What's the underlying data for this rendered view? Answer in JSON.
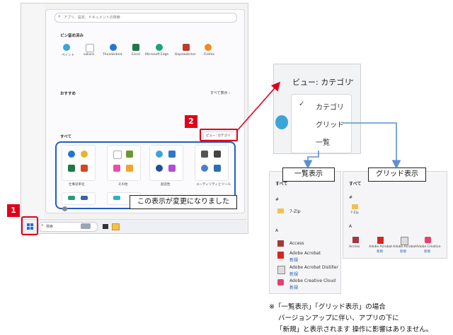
{
  "start_menu": {
    "search_placeholder": "アプリ、設定、ドキュメントの検索",
    "pinned_header": "ピン留め済み",
    "pinned_apps": [
      {
        "label": "ペイント",
        "color": "#3ba4d9"
      },
      {
        "label": "sakura",
        "color": "#ee6fa0"
      },
      {
        "label": "Thunderbird",
        "color": "#2276d8"
      },
      {
        "label": "Excel",
        "color": "#1d7a44"
      },
      {
        "label": "Microsoft Edge",
        "color": "#1aa27c"
      },
      {
        "label": "Dopewatcher",
        "color": "#c23b2a"
      },
      {
        "label": "Firefox",
        "color": "#f28a1e"
      }
    ],
    "recommended_header": "おすすめ",
    "show_all": "すべて表示 ›",
    "all_header": "すべて",
    "view_button": "ビュー: カテゴリ",
    "category_labels": [
      "仕事効率化",
      "その他",
      "創造性",
      "ユーティリティとツール"
    ],
    "user_icon": "user-icon"
  },
  "taskbar": {
    "search_text": "検索"
  },
  "annotations": {
    "badge1": "1",
    "badge2": "2",
    "changed_note": "この表示が変更になりました",
    "list_view_label": "一覧表示",
    "grid_view_label": "グリッド表示",
    "footnote_line1": "※「一覧表示」「グリッド表示」の場合",
    "footnote_line2": "バージョンアップに伴い、アプリの下に",
    "footnote_line3": "「新規」と表示されます 操作に影響はありません。"
  },
  "view_dropdown": {
    "button_label": "ビュー: カテゴリ",
    "options": [
      {
        "label": "カテゴリ",
        "checked": true
      },
      {
        "label": "グリッド",
        "checked": false
      },
      {
        "label": "一覧",
        "checked": false
      }
    ]
  },
  "list_panel": {
    "header": "すべて",
    "sections": [
      {
        "letter": "#",
        "items": [
          {
            "name": "7-Zip",
            "sub": ""
          }
        ]
      },
      {
        "letter": "A",
        "items": [
          {
            "name": "Access",
            "sub": ""
          },
          {
            "name": "Adobe Acrobat",
            "sub": "新規"
          },
          {
            "name": "Adobe Acrobat Distiller",
            "sub": "新規"
          },
          {
            "name": "Adobe Creative Cloud",
            "sub": "新規"
          }
        ]
      }
    ]
  },
  "grid_panel": {
    "header": "すべて",
    "hash": "#",
    "zip": "7-Zip",
    "letter_a": "A",
    "apps": [
      {
        "name": "Access",
        "sub": ""
      },
      {
        "name": "Adobe Acrobat",
        "sub": "新規"
      },
      {
        "name": "Adobe Acrobat",
        "sub": "新規"
      },
      {
        "name": "Adobe Creative",
        "sub": "新規"
      }
    ]
  },
  "colors": {
    "accent_red": "#e0001b",
    "accent_blue": "#1f5fbf",
    "arrow_blue": "#5b8fd0"
  }
}
